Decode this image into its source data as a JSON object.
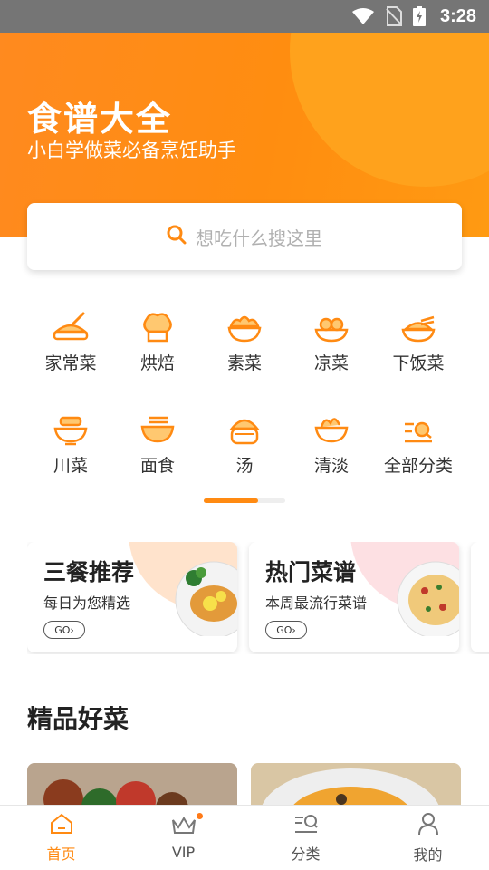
{
  "status_bar": {
    "time": "3:28"
  },
  "hero": {
    "title": "食谱大全",
    "subtitle": "小白学做菜必备烹饪助手"
  },
  "search": {
    "placeholder": "想吃什么搜这里"
  },
  "categories": [
    {
      "label": "家常菜",
      "icon": "cooking-pot-icon"
    },
    {
      "label": "烘焙",
      "icon": "chef-hat-icon"
    },
    {
      "label": "素菜",
      "icon": "veggie-bowl-icon"
    },
    {
      "label": "凉菜",
      "icon": "cold-dish-icon"
    },
    {
      "label": "下饭菜",
      "icon": "rice-bowl-icon"
    },
    {
      "label": "川菜",
      "icon": "hot-bowl-icon"
    },
    {
      "label": "面食",
      "icon": "noodle-bowl-icon"
    },
    {
      "label": "汤",
      "icon": "soup-pot-icon"
    },
    {
      "label": "清淡",
      "icon": "salad-bowl-icon"
    },
    {
      "label": "全部分类",
      "icon": "category-search-icon"
    }
  ],
  "promo_cards": [
    {
      "title": "三餐推荐",
      "subtitle": "每日为您精选",
      "button": "GO",
      "accent": "#ffe3cc"
    },
    {
      "title": "热门菜谱",
      "subtitle": "本周最流行菜谱",
      "button": "GO",
      "accent": "#fde0e3"
    }
  ],
  "section": {
    "title": "精品好菜"
  },
  "tabbar": [
    {
      "label": "首页",
      "icon": "home-icon",
      "active": true
    },
    {
      "label": "VIP",
      "icon": "crown-icon",
      "active": false
    },
    {
      "label": "分类",
      "icon": "category-icon",
      "active": false
    },
    {
      "label": "我的",
      "icon": "profile-icon",
      "active": false
    }
  ],
  "colors": {
    "accent": "#ff8a12",
    "hero": "#ff8d10"
  }
}
